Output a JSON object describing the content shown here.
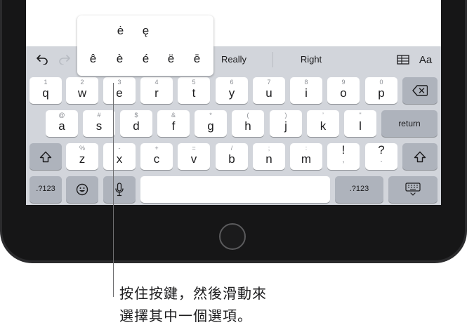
{
  "shortcut_bar": {
    "undo_icon": "undo-arrow-icon",
    "redo_icon": "redo-arrow-icon",
    "suggestions": [
      "Really",
      "Right"
    ],
    "table_icon": "table-icon",
    "format_label": "Aa"
  },
  "accent_popup": {
    "top_row": [
      "ė",
      "ę"
    ],
    "bottom_row": [
      "ê",
      "è",
      "é",
      "ë",
      "ē"
    ]
  },
  "keyboard": {
    "row1": [
      {
        "alt": "1",
        "key": "q"
      },
      {
        "alt": "2",
        "key": "w"
      },
      {
        "alt": "3",
        "key": "e"
      },
      {
        "alt": "4",
        "key": "r"
      },
      {
        "alt": "5",
        "key": "t"
      },
      {
        "alt": "6",
        "key": "y"
      },
      {
        "alt": "7",
        "key": "u"
      },
      {
        "alt": "8",
        "key": "i"
      },
      {
        "alt": "9",
        "key": "o"
      },
      {
        "alt": "0",
        "key": "p"
      }
    ],
    "row2": [
      {
        "alt": "@",
        "key": "a"
      },
      {
        "alt": "#",
        "key": "s"
      },
      {
        "alt": "$",
        "key": "d"
      },
      {
        "alt": "&",
        "key": "f"
      },
      {
        "alt": "*",
        "key": "g"
      },
      {
        "alt": "(",
        "key": "h"
      },
      {
        "alt": ")",
        "key": "j"
      },
      {
        "alt": "’",
        "key": "k"
      },
      {
        "alt": "\"",
        "key": "l"
      }
    ],
    "row3": [
      {
        "alt": "%",
        "key": "z"
      },
      {
        "alt": "-",
        "key": "x"
      },
      {
        "alt": "+",
        "key": "c"
      },
      {
        "alt": "=",
        "key": "v"
      },
      {
        "alt": "/",
        "key": "b"
      },
      {
        "alt": ";",
        "key": "n"
      },
      {
        "alt": ":",
        "key": "m"
      },
      {
        "alt": "!",
        "key": ","
      },
      {
        "alt": "?",
        "key": "."
      }
    ],
    "return_label": "return",
    "numbers_left_label": ".?123",
    "numbers_right_label": ".?123",
    "delete_icon": "delete-backspace-icon",
    "shift_icon": "shift-arrow-icon",
    "emoji_icon": "emoji-smiley-icon",
    "mic_icon": "microphone-icon",
    "hide_keyboard_icon": "keyboard-dismiss-icon"
  },
  "callout": {
    "line1": "按住按鍵，然後滑動來",
    "line2": "選擇其中一個選項。"
  }
}
